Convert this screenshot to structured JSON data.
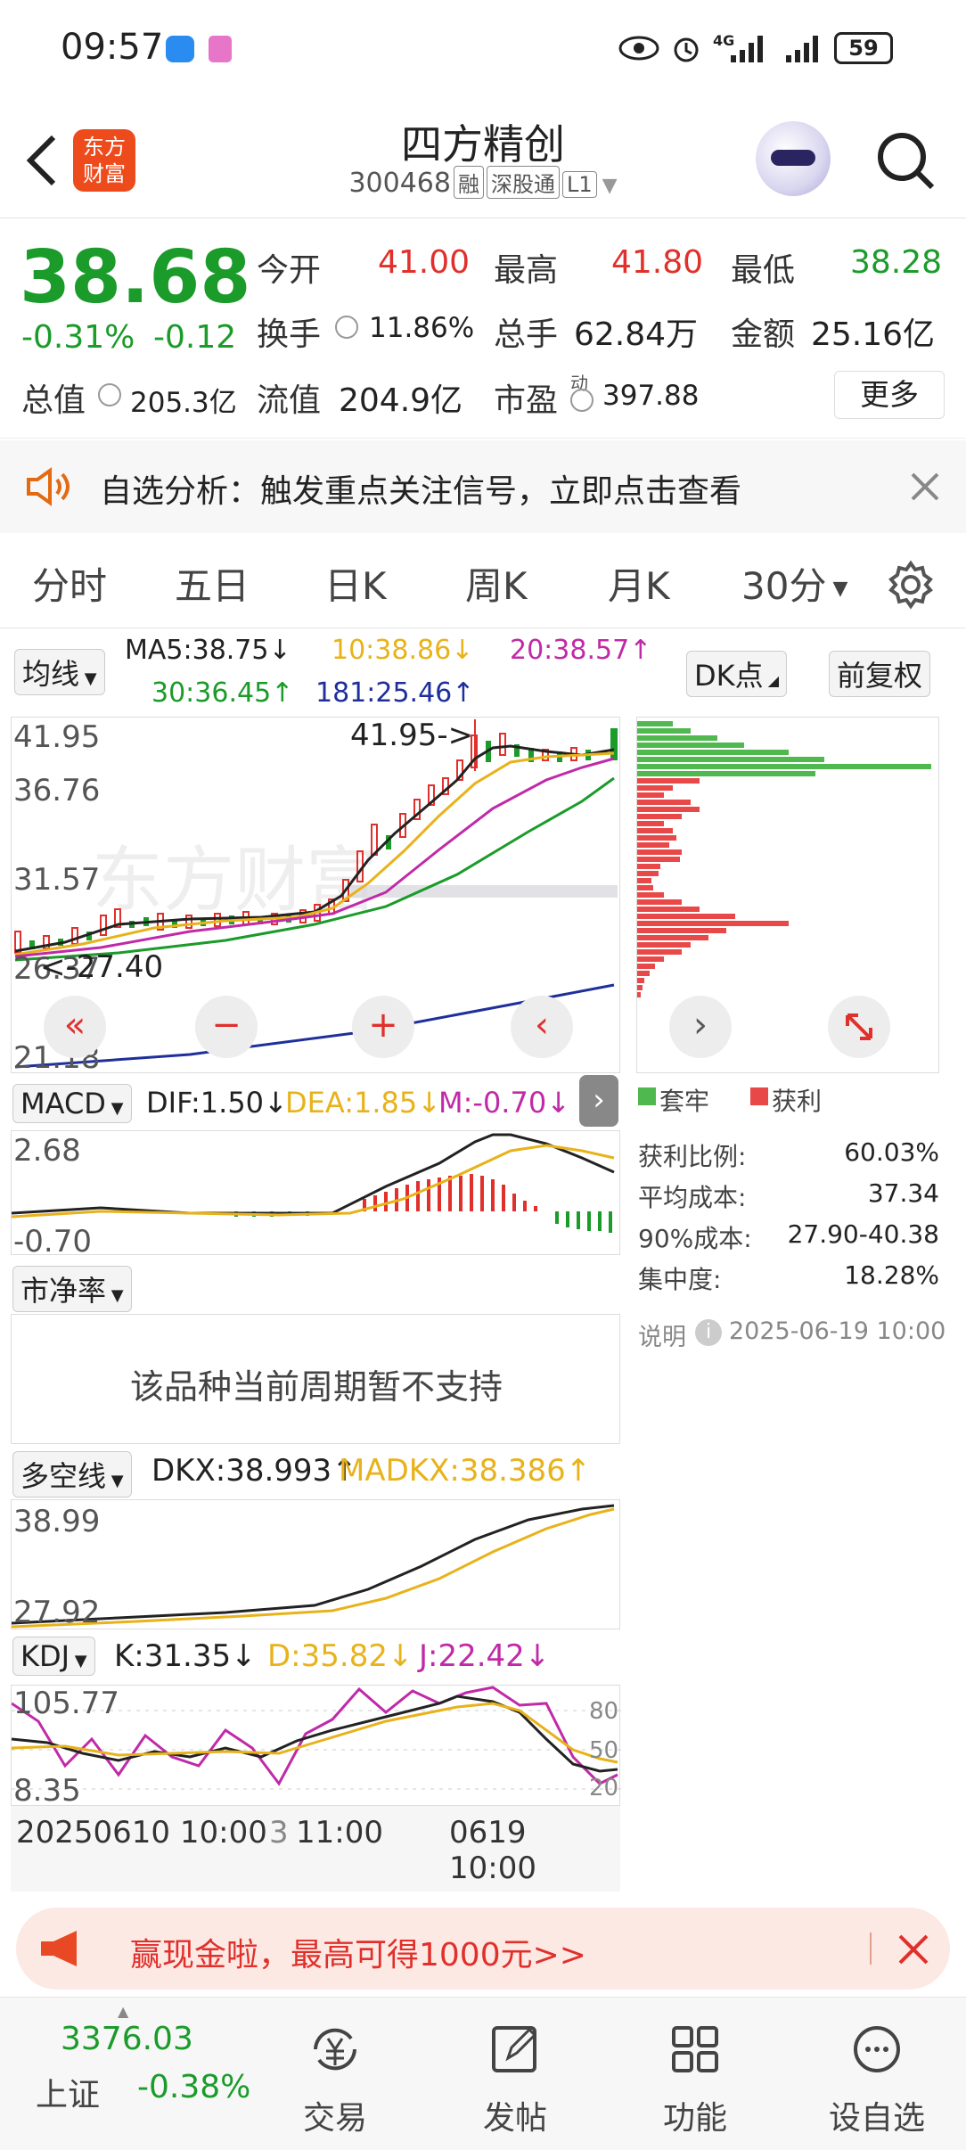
{
  "status": {
    "time": "09:57",
    "battery": "59",
    "net": "4G"
  },
  "header": {
    "logo_text_1": "东方",
    "logo_text_2": "财富",
    "name": "四方精创",
    "code": "300468",
    "tags": [
      "融",
      "深股通",
      "L1"
    ]
  },
  "quote": {
    "price": "38.68",
    "change_pct": "-0.31%",
    "change": "-0.12",
    "open_label": "今开",
    "open": "41.00",
    "high_label": "最高",
    "high": "41.80",
    "low_label": "最低",
    "low": "38.28",
    "turnover_label": "换手",
    "turnover": "11.86%",
    "volume_label": "总手",
    "volume": "62.84万",
    "amount_label": "金额",
    "amount": "25.16亿",
    "mcap_label": "总值",
    "mcap": "205.3亿",
    "float_label": "流值",
    "float": "204.9亿",
    "pe_label": "市盈",
    "pe_sup": "动",
    "pe": "397.88",
    "more": "更多"
  },
  "notice": {
    "text": "自选分析：触发重点关注信号，立即点击查看"
  },
  "tabs": [
    "分时",
    "五日",
    "日K",
    "周K",
    "月K",
    "30分"
  ],
  "ma": {
    "selector": "均线",
    "ma5": "MA5:38.75↓",
    "ma10": "10:38.86↓",
    "ma20": "20:38.57↑",
    "ma30": "30:36.45↑",
    "ma181": "181:25.46↑",
    "dk": "DK点",
    "adjust": "前复权"
  },
  "kline": {
    "y_labels": [
      "41.95",
      "36.76",
      "31.57",
      "26.37",
      "21.18"
    ],
    "max_marker": "41.95->",
    "min_marker": "<-27.40",
    "watermark": "东方财富"
  },
  "macd": {
    "selector": "MACD",
    "dif": "DIF:1.50↓",
    "dea": "DEA:1.85↓",
    "m": "M:-0.70↓",
    "y_top": "2.68",
    "y_bottom": "-0.70"
  },
  "pb": {
    "selector": "市净率",
    "unsupported": "该品种当前周期暂不支持"
  },
  "dkx": {
    "selector": "多空线",
    "dkx": "DKX:38.993↑",
    "madkx": "MADKX:38.386↑",
    "y_top": "38.99",
    "y_bottom": "27.92"
  },
  "kdj": {
    "selector": "KDJ",
    "k": "K:31.35↓",
    "d": "D:35.82↓",
    "j": "J:22.42↓",
    "y_top": "105.77",
    "y_bottom": "8.35",
    "levels": [
      "80",
      "50",
      "20"
    ]
  },
  "time_axis": {
    "start": "20250610 10:00",
    "mid_prefix": "3",
    "mid": "11:00",
    "end": "0619 10:00"
  },
  "chips": {
    "legend_trapped": "套牢",
    "legend_profit": "获利",
    "rows": [
      {
        "label": "获利比例:",
        "value": "60.03%"
      },
      {
        "label": "平均成本:",
        "value": "37.34"
      },
      {
        "label": "90%成本:",
        "value": "27.90-40.38"
      },
      {
        "label": "集中度:",
        "value": "18.28%"
      }
    ],
    "note_label": "说明",
    "note_time": "2025-06-19 10:00"
  },
  "banner": {
    "text": "赢现金啦，最高可得1000元>>"
  },
  "bottom": {
    "index_value": "3376.03",
    "index_name": "上证",
    "index_change": "-0.38%",
    "items": [
      "交易",
      "发帖",
      "功能",
      "设自选"
    ]
  },
  "colors": {
    "up": "#e0302c",
    "down": "#1a9b2a",
    "accent": "#e36a10",
    "ma10": "#e8b21a",
    "ma20": "#c02aa8",
    "ma30": "#1a9b2a",
    "ma181": "#1e2f9b"
  }
}
